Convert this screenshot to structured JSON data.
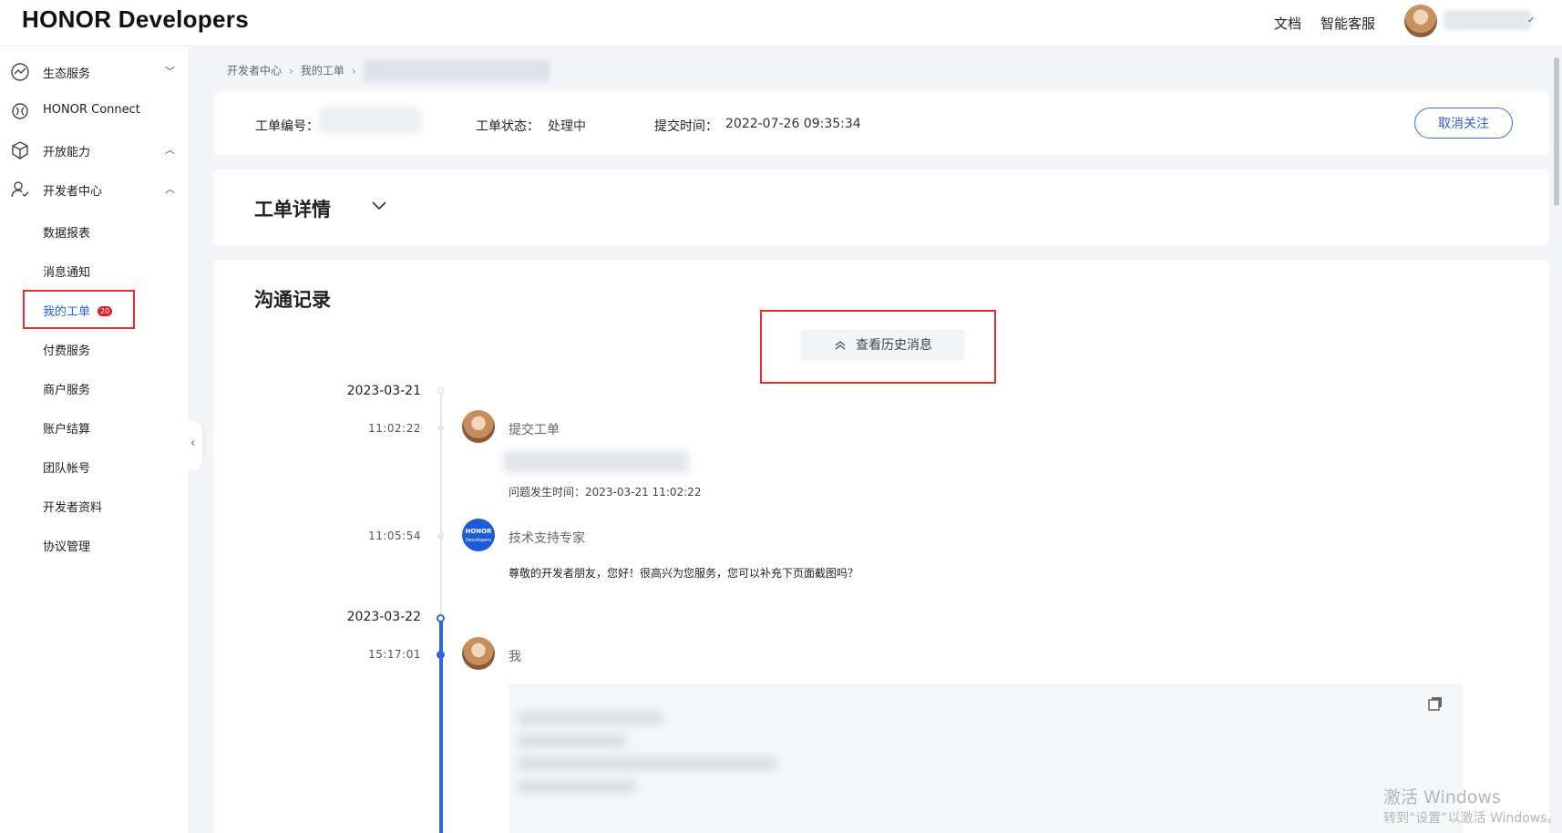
{
  "header": {
    "logo": "HONOR Developers",
    "links": [
      "文档",
      "智能客服"
    ]
  },
  "sidebar": {
    "items": [
      {
        "label": "生态服务",
        "icon": "trend-circle-icon",
        "expanded": false
      },
      {
        "label": "HONOR Connect",
        "icon": "connect-icon"
      },
      {
        "label": "开放能力",
        "icon": "cube-icon",
        "expanded": true
      },
      {
        "label": "开发者中心",
        "icon": "developer-icon",
        "expanded": true
      }
    ],
    "sub_items": [
      "数据报表",
      "消息通知",
      "我的工单",
      "付费服务",
      "商户服务",
      "账户结算",
      "团队帐号",
      "开发者资料",
      "协议管理"
    ],
    "active_sub": "我的工单",
    "badge": "20"
  },
  "breadcrumb": [
    "开发者中心",
    "我的工单"
  ],
  "ticket": {
    "id_label": "工单编号：",
    "status_label": "工单状态：",
    "status_value": "处理中",
    "submit_label": "提交时间：",
    "submit_value": "2022-07-26 09:35:34",
    "unfollow_button": "取消关注"
  },
  "details": {
    "title": "工单详情"
  },
  "communication": {
    "title": "沟通记录",
    "history_button": "查看历史消息",
    "entries": [
      {
        "date": "2023-03-21",
        "time": "11:02:22",
        "sender": "提交工单",
        "text": "问题发生时间：2023-03-21 11:02:22"
      },
      {
        "time": "11:05:54",
        "sender": "技术支持专家",
        "text": "尊敬的开发者朋友，您好！很高兴为您服务，您可以补充下页面截图吗？"
      },
      {
        "date": "2023-03-22",
        "time": "15:17:01",
        "sender": "我"
      }
    ],
    "expert_avatar_text": [
      "HONOR",
      "Developers"
    ]
  },
  "watermark": {
    "line1": "激活 Windows",
    "line2": "转到“设置”以激活 Windows。"
  },
  "colors": {
    "accent": "#2563eb",
    "badge": "#e11d2a",
    "highlight": "#e03030",
    "timeline_active": "#2f66db"
  }
}
